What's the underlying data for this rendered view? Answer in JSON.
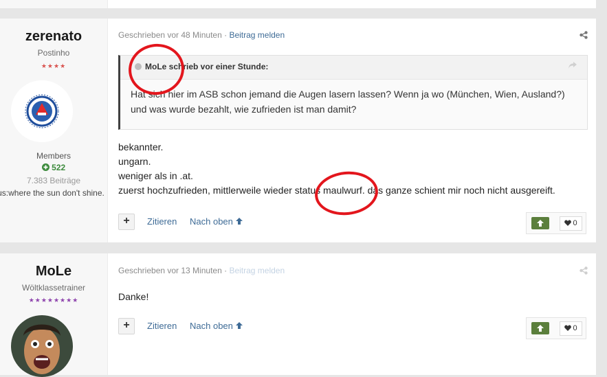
{
  "colors": {
    "link": "#3e6b96",
    "highlight": "#e3161d",
    "reaction": "#5b7f3c",
    "stars_p1": "#d9534f",
    "stars_p2": "#8e44ad"
  },
  "post1": {
    "author": {
      "name": "zerenato",
      "title": "Postinho",
      "stars": "★★★★",
      "avatar": "club-logo",
      "group": "Members",
      "reputation": "522",
      "posts": "7.383 Beiträge",
      "location": "Aus:where the sun don't shine."
    },
    "meta": {
      "written": "Geschrieben vor 48 Minuten",
      "separator": "·",
      "report": "Beitrag melden"
    },
    "quote": {
      "header": "MoLe schrieb vor einer Stunde:",
      "text": "Hat sich hier im ASB schon jemand die Augen lasern lassen? Wenn ja wo (München, Wien, Ausland?) und was wurde bezahlt, wie zufrieden ist man damit?"
    },
    "lines": [
      "bekannter.",
      "ungarn.",
      "weniger als in .at.",
      "zuerst hochzufrieden, mittlerweile wieder status maulwurf. das ganze schient mir noch nicht ausgereift."
    ],
    "actions": {
      "plus": "+",
      "quote": "Zitieren",
      "top": "Nach oben"
    },
    "likes": "0"
  },
  "post2": {
    "author": {
      "name": "MoLe",
      "title": "Wöltklassetrainer",
      "stars": "★★★★★★★★",
      "avatar": "portrait"
    },
    "meta": {
      "written": "Geschrieben vor 13 Minuten",
      "separator": "·",
      "report": "Beitrag melden"
    },
    "lines": [
      "Danke!"
    ],
    "actions": {
      "plus": "+",
      "quote": "Zitieren",
      "top": "Nach oben"
    },
    "likes": "0"
  }
}
